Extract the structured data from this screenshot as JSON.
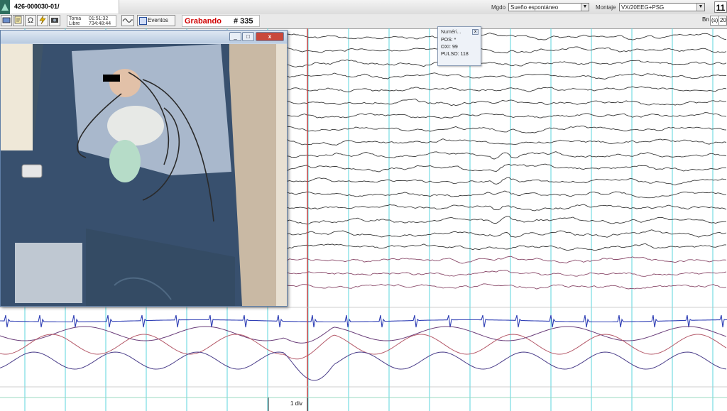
{
  "header": {
    "study_id": "426-000030-01/",
    "mode_label": "Mgdo",
    "mode_value": "Sueño espontáneo",
    "montage_label": "Montaje",
    "montage_value": "VX/20EEG+PSG",
    "page": "11"
  },
  "toolbar": {
    "toma_label": "Toma",
    "toma_value": "01:51:32",
    "libre_label": "Libre",
    "libre_value": "734:48:44",
    "eventos_label": "Eventos",
    "recording_label": "Grabando",
    "recording_number": "# 335",
    "right_controls": [
      "Bn",
      "(s)",
      "20"
    ]
  },
  "video_window": {
    "min_label": "_",
    "max_label": "□",
    "close_label": "x"
  },
  "numeric_popup": {
    "title": "Numéri...",
    "close_label": "x",
    "pos": "POS: *",
    "oxi": "OXI: 99",
    "pulso": "PULSO: 118"
  },
  "scale": {
    "div_label": "1 div"
  },
  "colors": {
    "record_red": "#d00000",
    "cursor_red": "#e23b3b",
    "grid_cyan": "#3fd0d8",
    "trace_dark": "#3a3a3a",
    "ecg_blue": "#2f3fb5",
    "trace_purple": "#6a3e7a"
  }
}
